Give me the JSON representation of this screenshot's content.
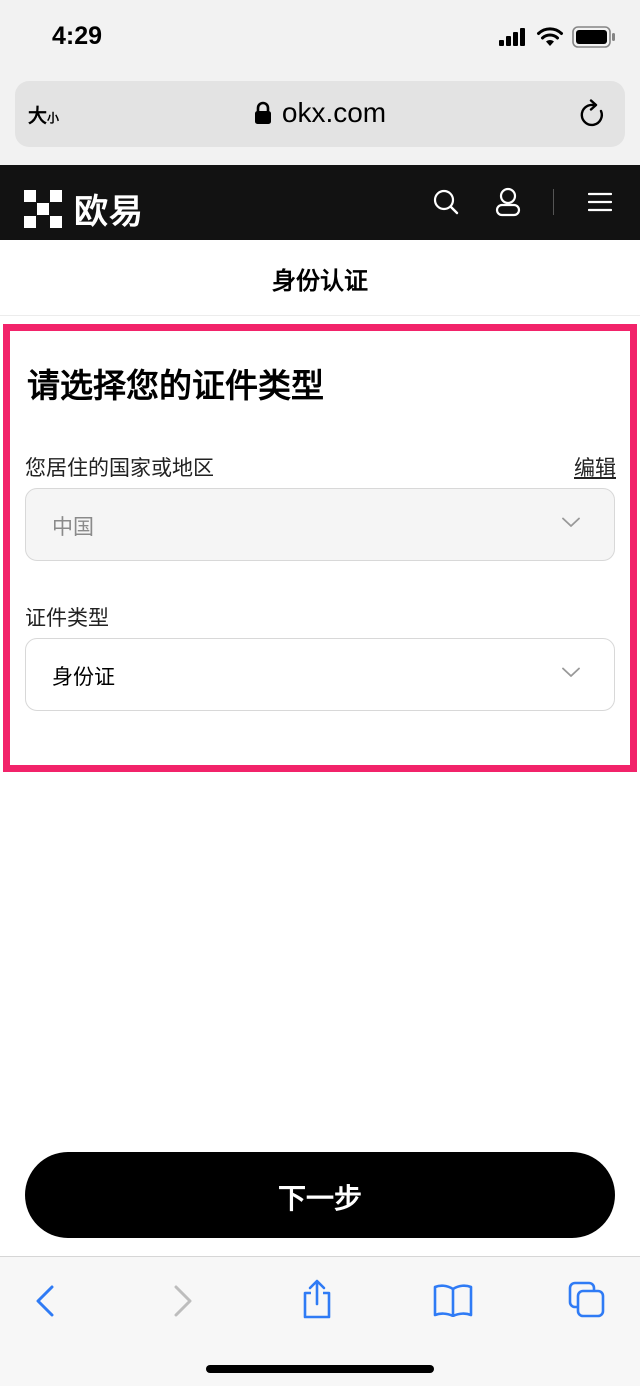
{
  "status_bar": {
    "time": "4:29"
  },
  "url_bar": {
    "text_size_big": "大",
    "text_size_small": "小",
    "url": "okx.com"
  },
  "site_nav": {
    "brand": "欧易"
  },
  "page": {
    "title": "身份认证"
  },
  "form": {
    "heading": "请选择您的证件类型",
    "country_label": "您居住的国家或地区",
    "edit_label": "编辑",
    "country_value": "中国",
    "doc_type_label": "证件类型",
    "doc_type_value": "身份证"
  },
  "next_button": {
    "label": "下一步"
  },
  "colors": {
    "highlight_border": "#f2236a",
    "nav_background": "#121212",
    "toolbar_icon_active": "#2f7bf5",
    "toolbar_icon_disabled": "#bdbdbd"
  },
  "icons": {
    "status": [
      "signal-icon",
      "wifi-icon",
      "battery-icon"
    ],
    "url_bar": [
      "lock-icon",
      "reload-icon"
    ],
    "site_nav": [
      "okx-logo-icon",
      "search-icon",
      "user-icon",
      "menu-icon"
    ],
    "form": [
      "chevron-down-icon"
    ],
    "toolbar": [
      "back-icon",
      "forward-icon",
      "share-icon",
      "bookmarks-icon",
      "tabs-icon"
    ]
  }
}
